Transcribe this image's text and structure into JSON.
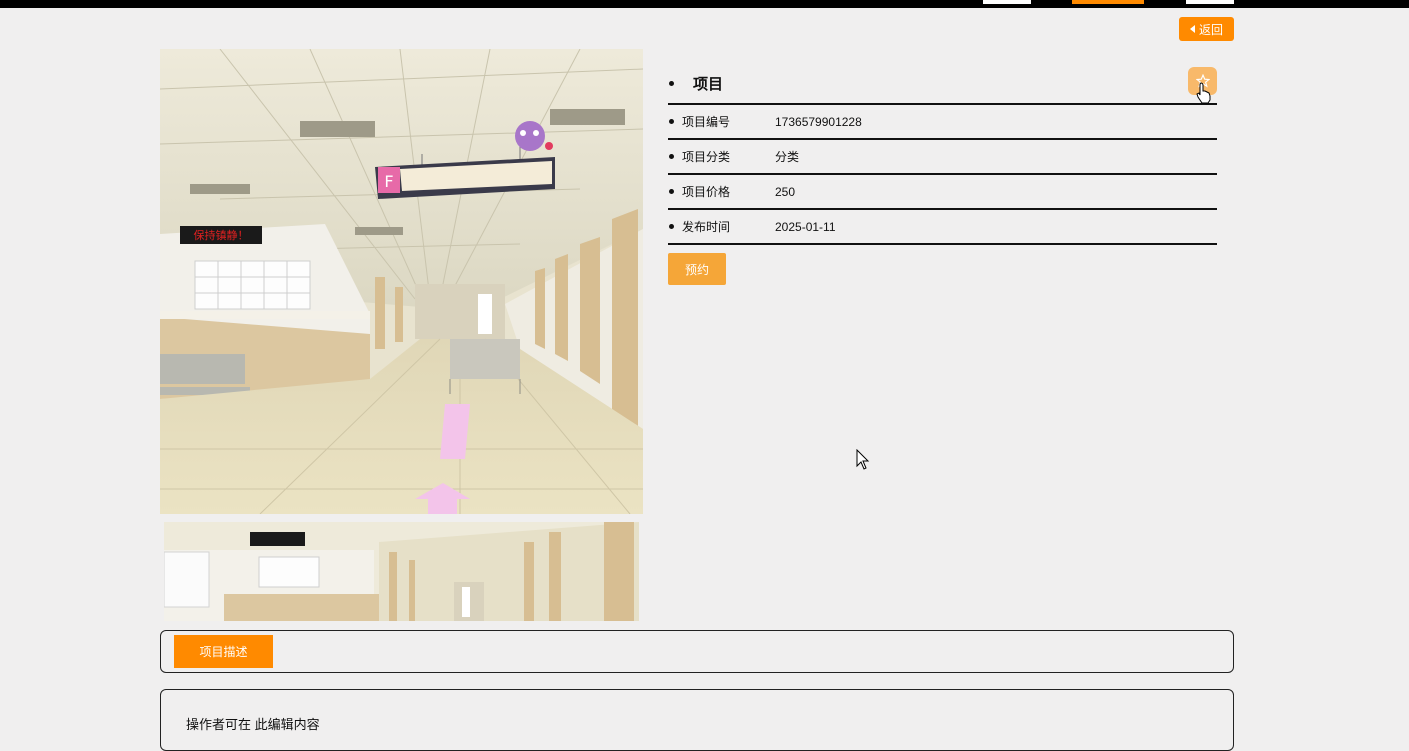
{
  "header": {
    "back_label": "返回"
  },
  "item": {
    "title": "项目",
    "rows": [
      {
        "label": "项目编号",
        "value": "1736579901228"
      },
      {
        "label": "项目分类",
        "value": "分类"
      },
      {
        "label": "项目价格",
        "value": "250"
      },
      {
        "label": "发布时间",
        "value": "2025-01-11"
      }
    ],
    "book_label": "预约"
  },
  "scene": {
    "led_sign": "保持镇静！",
    "signboard_letter": "F"
  },
  "tabs": [
    {
      "label": "项目描述"
    }
  ],
  "description": {
    "text": "操作者可在 此编辑内容"
  },
  "colors": {
    "accent": "#ff8a00",
    "button": "#f5a638",
    "favorite": "#f8b96a",
    "background": "#f0efef"
  },
  "icons": {
    "back": "caret-left-icon",
    "favorite": "star-icon"
  }
}
